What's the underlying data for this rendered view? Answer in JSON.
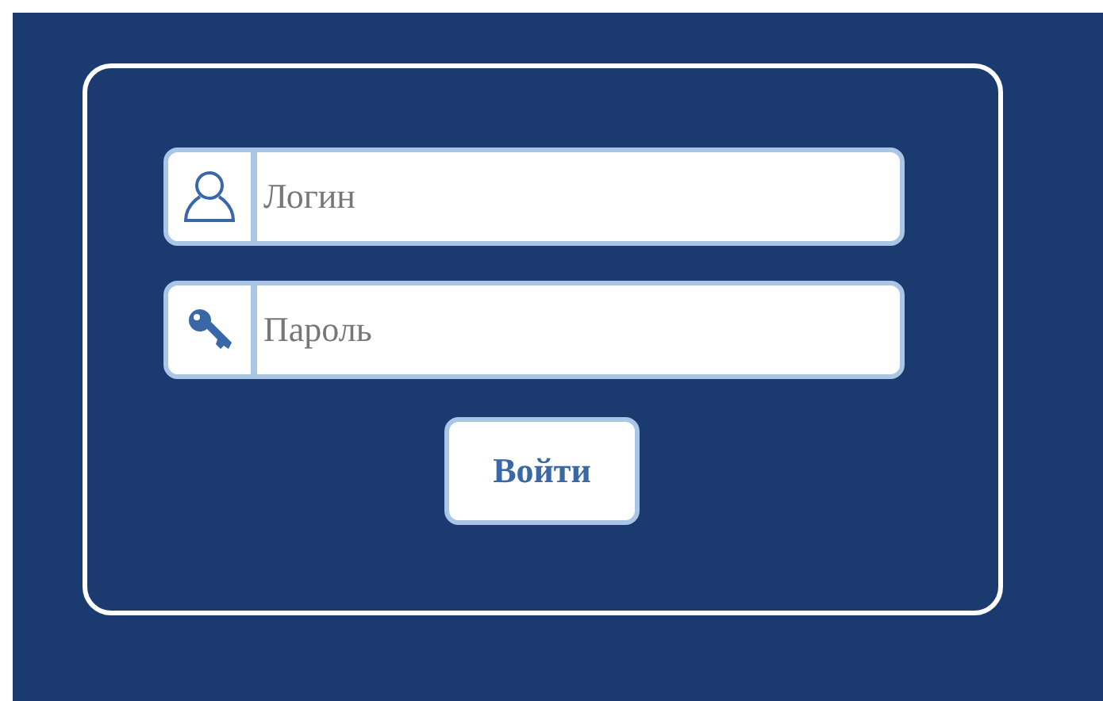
{
  "login_form": {
    "fields": [
      {
        "kind": "user",
        "placeholder": "Логин"
      },
      {
        "kind": "key",
        "placeholder": "Пароль"
      }
    ],
    "submit_button": {
      "label": "Войти"
    }
  }
}
